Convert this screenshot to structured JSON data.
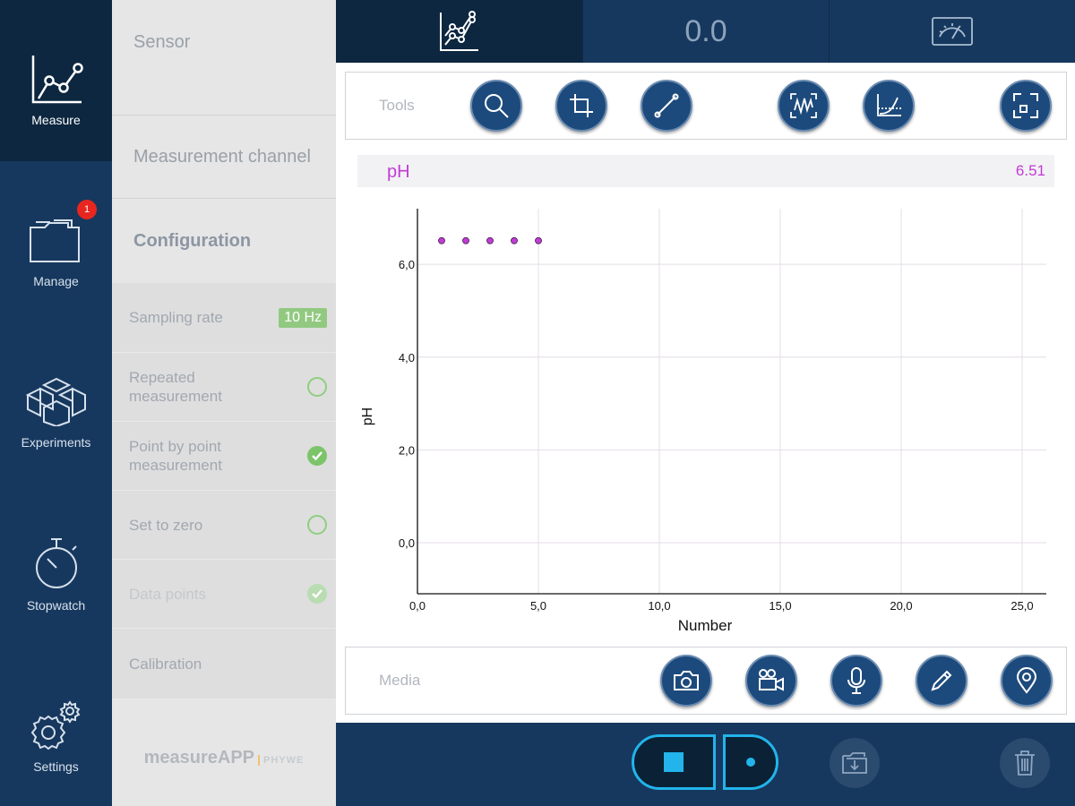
{
  "nav": {
    "items": [
      {
        "label": "Measure",
        "icon": "line-chart-icon"
      },
      {
        "label": "Manage",
        "icon": "folder-icon",
        "badge": "1"
      },
      {
        "label": "Experiments",
        "icon": "cubes-icon"
      },
      {
        "label": "Stopwatch",
        "icon": "stopwatch-icon"
      },
      {
        "label": "Settings",
        "icon": "gears-icon"
      }
    ]
  },
  "panel": {
    "sensor": "Sensor",
    "channel": "Measurement channel",
    "configuration": "Configuration",
    "sampling_rate": {
      "label": "Sampling rate",
      "value": "10 Hz"
    },
    "repeated": {
      "label": "Repeated measurement",
      "checked": false
    },
    "point_by_point": {
      "label": "Point by point measurement",
      "checked": true
    },
    "set_to_zero": {
      "label": "Set to zero",
      "checked": false
    },
    "data_points": {
      "label": "Data points",
      "checked": true,
      "enabled": false
    },
    "calibration": "Calibration",
    "logo": {
      "name": "measureAPP",
      "brand": "PHYWE"
    }
  },
  "top_tabs": {
    "value": "0.0",
    "items": [
      "chart-tab-icon",
      "value-tab",
      "gauge-tab-icon"
    ]
  },
  "tools": {
    "label": "Tools",
    "buttons": [
      "zoom-icon",
      "crop-icon",
      "line-tool-icon",
      "fit-wave-icon",
      "curve-axes-icon",
      "fullscreen-icon"
    ]
  },
  "channel": {
    "name": "pH",
    "value": "6.51",
    "color": "#c23bd6"
  },
  "media": {
    "label": "Media",
    "buttons": [
      "camera-icon",
      "video-camera-icon",
      "microphone-icon",
      "pencil-icon",
      "location-pin-icon"
    ]
  },
  "bottom": {
    "buttons": [
      "stop-icon",
      "record-point-icon",
      "folder-download-icon",
      "trash-icon"
    ]
  },
  "chart_data": {
    "type": "scatter",
    "xlabel": "Number",
    "ylabel": "pH",
    "xlim": [
      0,
      26
    ],
    "ylim": [
      -1.1,
      7.2
    ],
    "x_ticks": [
      0,
      5,
      10,
      15,
      20,
      25
    ],
    "y_ticks": [
      0,
      2,
      4,
      6
    ],
    "x_tick_labels": [
      "0,0",
      "5,0",
      "10,0",
      "15,0",
      "20,0",
      "25,0"
    ],
    "y_tick_labels": [
      "0,0",
      "2,0",
      "4,0",
      "6,0"
    ],
    "grid": true,
    "series": [
      {
        "x": [
          1,
          2,
          3,
          4,
          5
        ],
        "y": [
          6.51,
          6.51,
          6.51,
          6.51,
          6.51
        ],
        "color": "#c23bd6"
      }
    ]
  }
}
